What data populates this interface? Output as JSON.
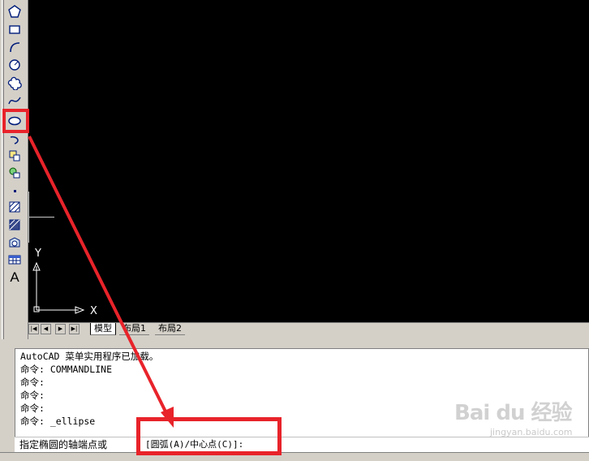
{
  "toolbar": {
    "icons": [
      "polygon-icon",
      "rectangle-icon",
      "arc-icon",
      "circle-icon",
      "revcloud-icon",
      "spline-icon",
      "ellipse-icon",
      "ellipse-arc-icon",
      "insert-block-icon",
      "make-block-icon",
      "point-icon",
      "hatch-icon",
      "gradient-icon",
      "region-icon",
      "table-icon",
      "multiline-text-icon"
    ],
    "text_tool_label": "A"
  },
  "ucs": {
    "x_label": "X",
    "y_label": "Y"
  },
  "layout_tabs": {
    "nav": [
      "|◀",
      "◀",
      "▶",
      "▶|"
    ],
    "tabs": [
      {
        "label": "模型",
        "active": true
      },
      {
        "label": "布局1",
        "active": false
      },
      {
        "label": "布局2",
        "active": false
      }
    ]
  },
  "command_window": {
    "history": [
      "AutoCAD 菜单实用程序已加载。",
      "命令: COMMANDLINE",
      "命令:",
      "命令:",
      "命令:",
      "命令: _ellipse"
    ],
    "prompt": "指定椭圆的轴端点或",
    "options": "[圆弧(A)/中心点(C)]:"
  },
  "watermark": {
    "brand": "Bai du 经验",
    "url": "jingyan.baidu.com"
  },
  "colors": {
    "highlight": "#e8232a",
    "canvas": "#000000",
    "chrome": "#d4d0c8"
  }
}
